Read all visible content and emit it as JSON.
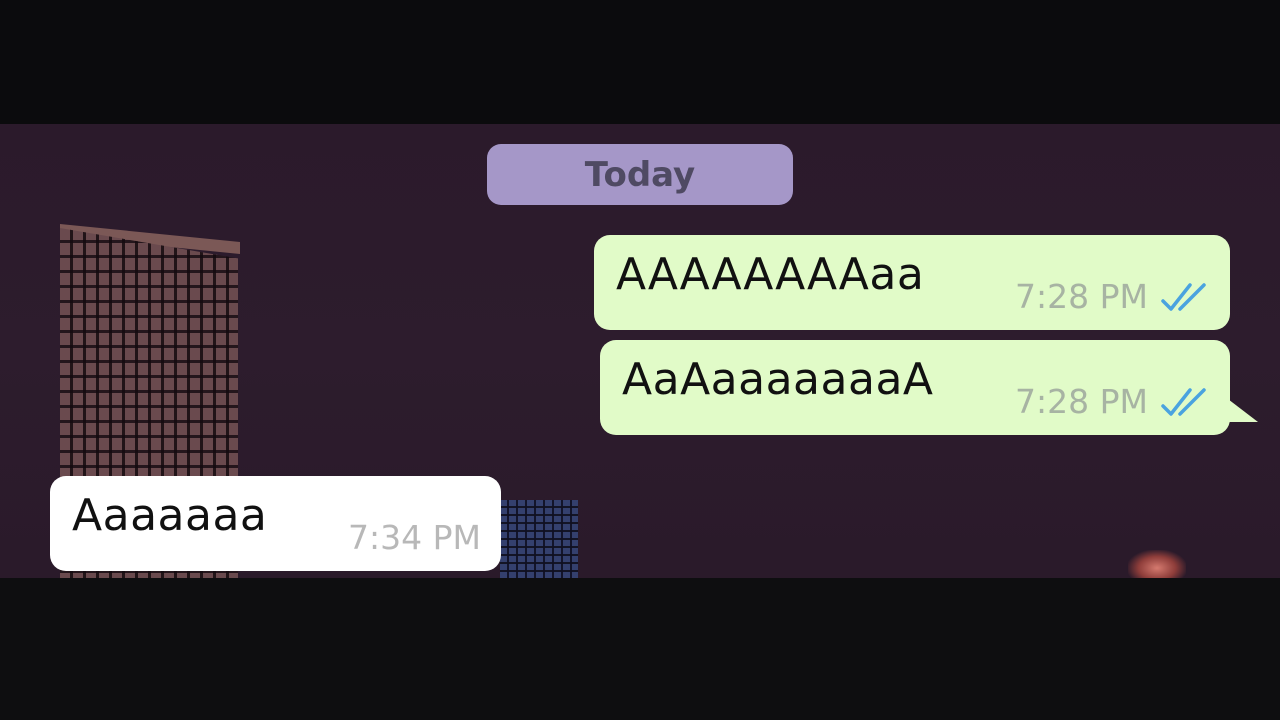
{
  "date_divider": {
    "label": "Today"
  },
  "messages": [
    {
      "direction": "outgoing",
      "text": "AAAAAAAAaa",
      "time": "7:28 PM",
      "status_icon": "double-check-icon"
    },
    {
      "direction": "outgoing",
      "text": "AaAaaaaaaaA",
      "time": "7:28 PM",
      "status_icon": "double-check-icon"
    },
    {
      "direction": "incoming",
      "text": "Aaaaaaa",
      "time": "7:34 PM"
    }
  ],
  "colors": {
    "outgoing_bubble": "#e1fbc8",
    "incoming_bubble": "#ffffff",
    "date_chip": "#a597c8",
    "read_ticks": "#4aa3df",
    "wallpaper": "#2c1b2c"
  }
}
